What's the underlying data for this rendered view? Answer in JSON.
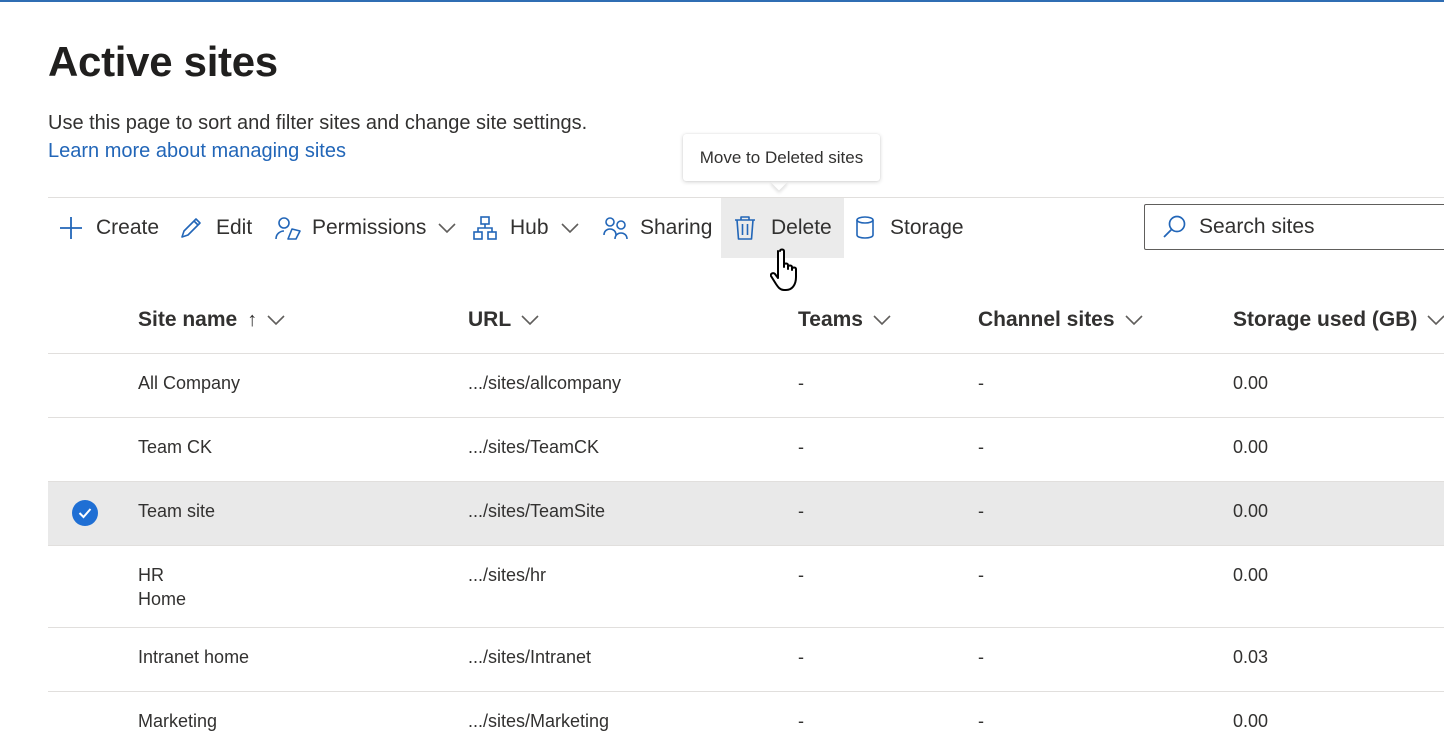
{
  "page": {
    "title": "Active sites",
    "description": "Use this page to sort and filter sites and change site settings.",
    "learn_more": "Learn more about managing sites"
  },
  "tooltip": {
    "text": "Move to Deleted sites"
  },
  "toolbar": {
    "create": "Create",
    "edit": "Edit",
    "permissions": "Permissions",
    "hub": "Hub",
    "sharing": "Sharing",
    "delete": "Delete",
    "storage": "Storage"
  },
  "search": {
    "placeholder": "Search sites"
  },
  "table": {
    "columns": {
      "site_name": "Site name",
      "sort_arrow": "↑",
      "url": "URL",
      "teams": "Teams",
      "channel_sites": "Channel sites",
      "storage": "Storage used (GB)"
    },
    "rows": [
      {
        "name": "All Company",
        "name2": "",
        "url": ".../sites/allcompany",
        "teams": "-",
        "channel": "-",
        "storage": "0.00",
        "selected": false
      },
      {
        "name": "Team CK",
        "name2": "",
        "url": ".../sites/TeamCK",
        "teams": "-",
        "channel": "-",
        "storage": "0.00",
        "selected": false
      },
      {
        "name": "Team site",
        "name2": "",
        "url": ".../sites/TeamSite",
        "teams": "-",
        "channel": "-",
        "storage": "0.00",
        "selected": true
      },
      {
        "name": "HR",
        "name2": "Home",
        "url": ".../sites/hr",
        "teams": "-",
        "channel": "-",
        "storage": "0.00",
        "selected": false
      },
      {
        "name": "Intranet home",
        "name2": "",
        "url": ".../sites/Intranet",
        "teams": "-",
        "channel": "-",
        "storage": "0.03",
        "selected": false
      },
      {
        "name": "Marketing",
        "name2": "",
        "url": ".../sites/Marketing",
        "teams": "-",
        "channel": "-",
        "storage": "0.00",
        "selected": false
      }
    ]
  },
  "colors": {
    "accent": "#2266b8",
    "selected_row": "#e9e9e9",
    "checkmark": "#1f6fd4",
    "delete_hover": "#ebebeb"
  },
  "icons": {
    "create": "plus-icon",
    "edit": "pencil-icon",
    "permissions": "person-key-icon",
    "hub": "hub-icon",
    "sharing": "people-icon",
    "delete": "trash-icon",
    "storage": "database-icon",
    "search": "search-icon"
  }
}
